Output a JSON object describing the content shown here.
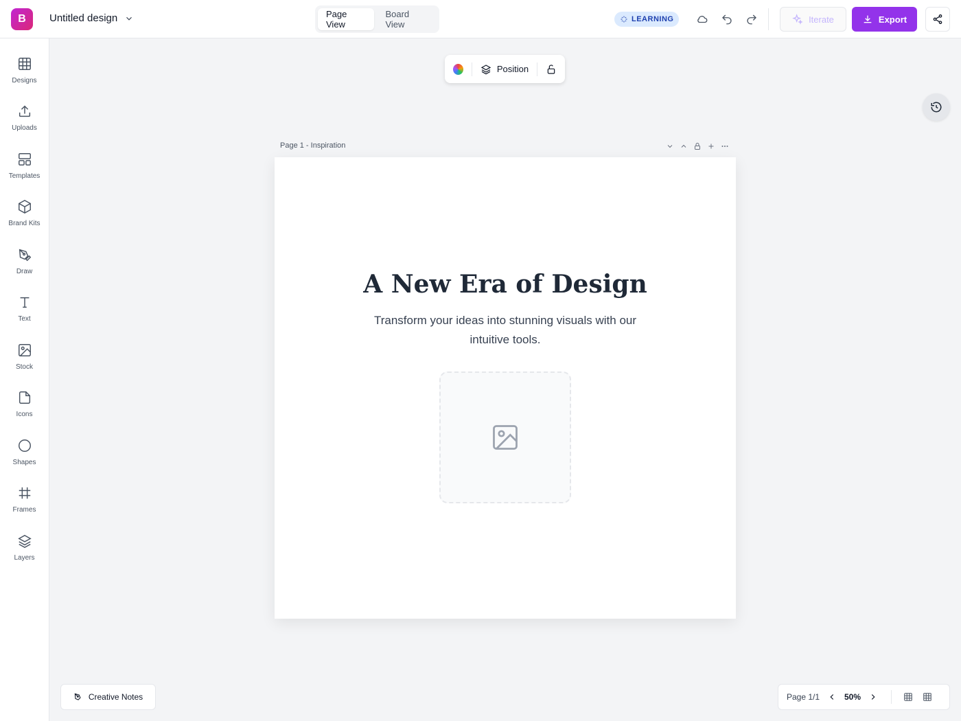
{
  "header": {
    "logo_letter": "B",
    "doc_title": "Untitled design",
    "views": [
      "Page View",
      "Board View"
    ],
    "badge": "LEARNING",
    "iterate_label": "Iterate",
    "export_label": "Export"
  },
  "sidebar": {
    "items": [
      {
        "label": "Designs",
        "icon": "grid-icon"
      },
      {
        "label": "Uploads",
        "icon": "upload-icon"
      },
      {
        "label": "Templates",
        "icon": "templates-icon"
      },
      {
        "label": "Brand Kits",
        "icon": "cube-icon"
      },
      {
        "label": "Draw",
        "icon": "pen-icon"
      },
      {
        "label": "Text",
        "icon": "text-icon"
      },
      {
        "label": "Stock",
        "icon": "image-icon"
      },
      {
        "label": "Icons",
        "icon": "file-icon"
      },
      {
        "label": "Shapes",
        "icon": "circle-icon"
      },
      {
        "label": "Frames",
        "icon": "frame-icon"
      },
      {
        "label": "Layers",
        "icon": "layers-icon"
      }
    ]
  },
  "float_toolbar": {
    "position_label": "Position"
  },
  "page": {
    "label": "Page 1 - Inspiration",
    "title": "A New Era of Design",
    "subtitle": "Transform your ideas into stunning visuals with our intuitive tools."
  },
  "footer": {
    "notes_label": "Creative Notes",
    "page_indicator": "Page 1/1",
    "zoom": "50%"
  },
  "colors": {
    "accent": "#9333ea",
    "badge_bg": "#dbeafe",
    "badge_text": "#1e40af"
  }
}
